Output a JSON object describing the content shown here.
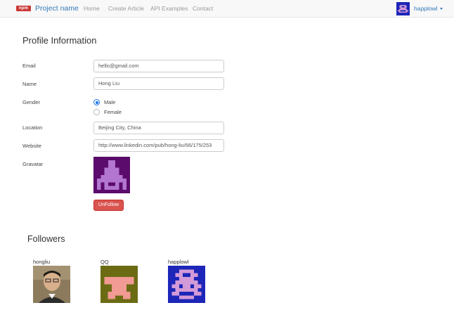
{
  "navbar": {
    "logo_text": "npm",
    "brand": "Project name",
    "links": [
      "Home",
      "Create Article",
      "API Examples",
      "Contact"
    ],
    "user": "happlowl"
  },
  "profile": {
    "title": "Profile Information",
    "email_label": "Email",
    "email_value": "hello@gmail.com",
    "name_label": "Name",
    "name_value": "Hong Liu",
    "gender_label": "Gender",
    "gender_options": [
      "Male",
      "Female"
    ],
    "gender_selected": "Male",
    "location_label": "Location",
    "location_value": "Beijing City, China",
    "website_label": "Website",
    "website_value": "http://www.linkedin.com/pub/hong-liu/66/175/253",
    "gravatar_label": "Gravatar",
    "unfollow_label": "UnFollow"
  },
  "followers": {
    "title": "Followers",
    "items": [
      {
        "name": "hongliu"
      },
      {
        "name": "QQ"
      },
      {
        "name": "happlowl"
      }
    ]
  },
  "colors": {
    "accent": "#337ab7",
    "danger": "#d9534f",
    "gravatar_bg": "#5b0b6b",
    "gravatar_fg": "#b276d0",
    "qq_bg": "#6b6b14",
    "qq_fg": "#f29a94",
    "happlowl_bg": "#1d26b8",
    "happlowl_fg": "#d49ad8"
  }
}
